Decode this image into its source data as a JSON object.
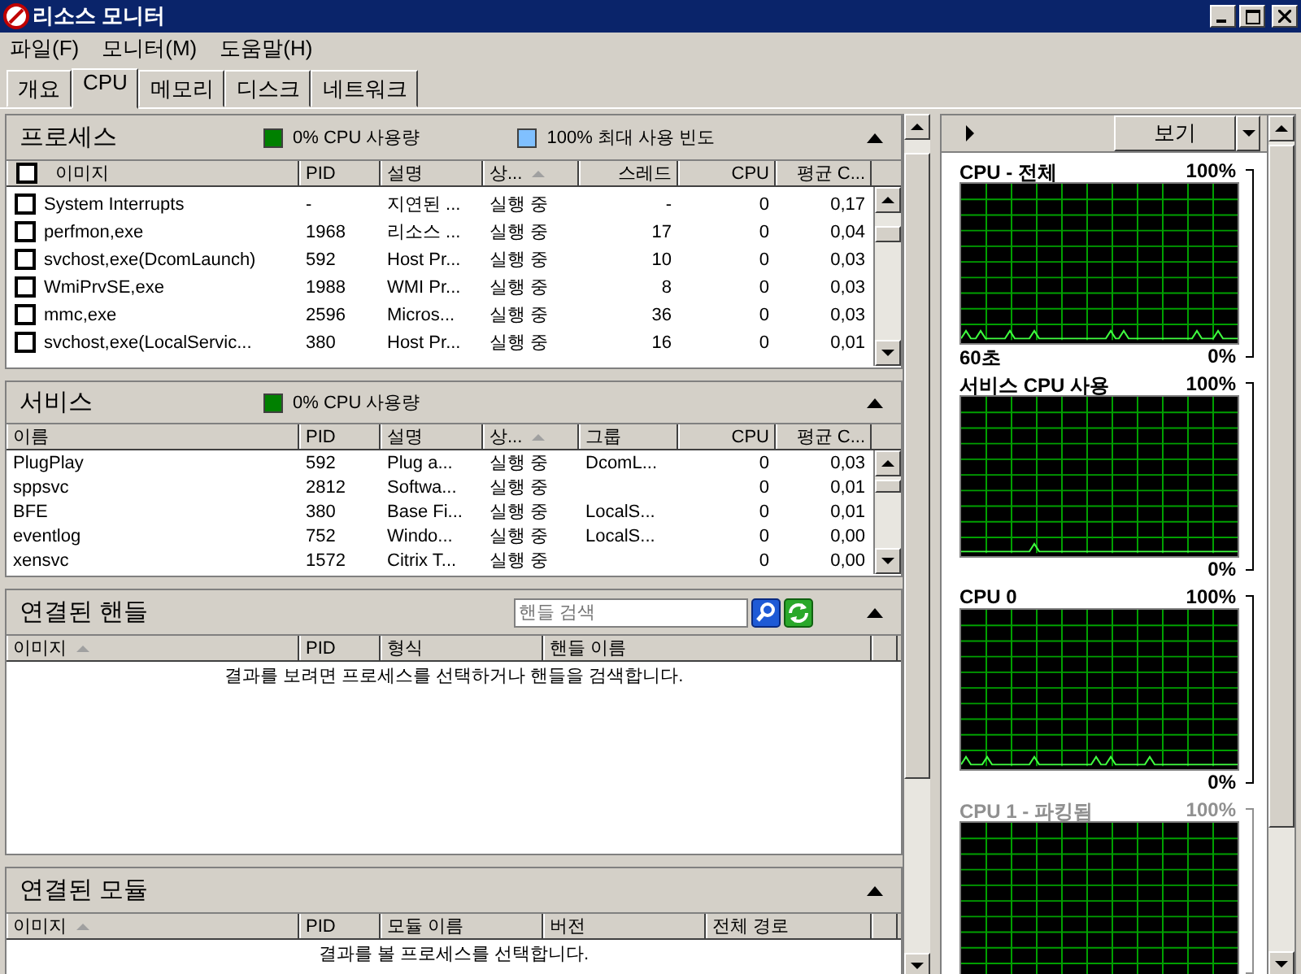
{
  "window": {
    "title": "리소스 모니터"
  },
  "menu": [
    "파일(F)",
    "모니터(M)",
    "도움말(H)"
  ],
  "tabs": [
    {
      "label": "개요",
      "selected": false
    },
    {
      "label": "CPU",
      "selected": true
    },
    {
      "label": "메모리",
      "selected": false
    },
    {
      "label": "디스크",
      "selected": false
    },
    {
      "label": "네트워크",
      "selected": false
    }
  ],
  "processes": {
    "title": "프로세스",
    "legend": [
      {
        "kind": "cpu",
        "text": "0% CPU 사용량"
      },
      {
        "kind": "frequency",
        "text": "100% 최대 사용 빈도"
      }
    ],
    "select_all_checked": false,
    "columns": [
      {
        "label": "이미지",
        "sorted": false
      },
      {
        "label": "PID",
        "sorted": false
      },
      {
        "label": "설명",
        "sorted": false
      },
      {
        "label": "상...",
        "sorted": true
      },
      {
        "label": "스레드",
        "sorted": false
      },
      {
        "label": "CPU",
        "sorted": false
      },
      {
        "label": "평균 C...",
        "sorted": false
      }
    ],
    "rows": [
      {
        "checked": false,
        "cells": [
          "System Interrupts",
          "-",
          "지연된 ...",
          "실행 중",
          "-",
          "0",
          "0,17"
        ]
      },
      {
        "checked": false,
        "cells": [
          "perfmon,exe",
          "1968",
          "리소스 ...",
          "실행 중",
          "17",
          "0",
          "0,04"
        ]
      },
      {
        "checked": false,
        "cells": [
          "svchost,exe(DcomLaunch)",
          "592",
          "Host Pr...",
          "실행 중",
          "10",
          "0",
          "0,03"
        ]
      },
      {
        "checked": false,
        "cells": [
          "WmiPrvSE,exe",
          "1988",
          "WMI Pr...",
          "실행 중",
          "8",
          "0",
          "0,03"
        ]
      },
      {
        "checked": false,
        "cells": [
          "mmc,exe",
          "2596",
          "Micros...",
          "실행 중",
          "36",
          "0",
          "0,03"
        ]
      },
      {
        "checked": false,
        "cells": [
          "svchost,exe(LocalServic...",
          "380",
          "Host Pr...",
          "실행 중",
          "16",
          "0",
          "0,01"
        ]
      }
    ]
  },
  "services": {
    "title": "서비스",
    "legend": [
      {
        "kind": "cpu",
        "text": "0% CPU 사용량"
      }
    ],
    "columns": [
      {
        "label": "이름",
        "sorted": false
      },
      {
        "label": "PID",
        "sorted": false
      },
      {
        "label": "설명",
        "sorted": false
      },
      {
        "label": "상...",
        "sorted": true
      },
      {
        "label": "그룹",
        "sorted": false
      },
      {
        "label": "CPU",
        "sorted": false
      },
      {
        "label": "평균 C...",
        "sorted": false
      }
    ],
    "rows": [
      {
        "cells": [
          "PlugPlay",
          "592",
          "Plug a...",
          "실행 중",
          "DcomL...",
          "0",
          "0,03"
        ]
      },
      {
        "cells": [
          "sppsvc",
          "2812",
          "Softwa...",
          "실행 중",
          "",
          "0",
          "0,01"
        ]
      },
      {
        "cells": [
          "BFE",
          "380",
          "Base Fi...",
          "실행 중",
          "LocalS...",
          "0",
          "0,01"
        ]
      },
      {
        "cells": [
          "eventlog",
          "752",
          "Windo...",
          "실행 중",
          "LocalS...",
          "0",
          "0,00"
        ]
      },
      {
        "cells": [
          "xensvc",
          "1572",
          "Citrix T...",
          "실행 중",
          "",
          "0",
          "0,00"
        ]
      }
    ]
  },
  "handles": {
    "title": "연결된 핸들",
    "search": {
      "placeholder": "핸들 검색"
    },
    "columns": [
      {
        "label": "이미지",
        "sorted": true
      },
      {
        "label": "PID",
        "sorted": false
      },
      {
        "label": "형식",
        "sorted": false
      },
      {
        "label": "핸들 이름",
        "sorted": false
      }
    ],
    "message": "결과를 보려면 프로세스를 선택하거나 핸들을 검색합니다."
  },
  "modules": {
    "title": "연결된 모듈",
    "columns": [
      {
        "label": "이미지",
        "sorted": true
      },
      {
        "label": "PID",
        "sorted": false
      },
      {
        "label": "모듈 이름",
        "sorted": false
      },
      {
        "label": "버전",
        "sorted": false
      },
      {
        "label": "전체 경로",
        "sorted": false
      }
    ],
    "message": "결과를 볼 프로세스를 선택합니다."
  },
  "graph_panel": {
    "view_button": "보기",
    "graphs": [
      {
        "title": "CPU - 전체",
        "max": "100%",
        "min": "0%",
        "time": "60초",
        "parked": false
      },
      {
        "title": "서비스 CPU 사용",
        "max": "100%",
        "min": "0%",
        "parked": false
      },
      {
        "title": "CPU 0",
        "max": "100%",
        "min": "0%",
        "parked": false
      },
      {
        "title": "CPU 1 - 파킹됨",
        "max": "100%",
        "parked": true
      }
    ]
  }
}
